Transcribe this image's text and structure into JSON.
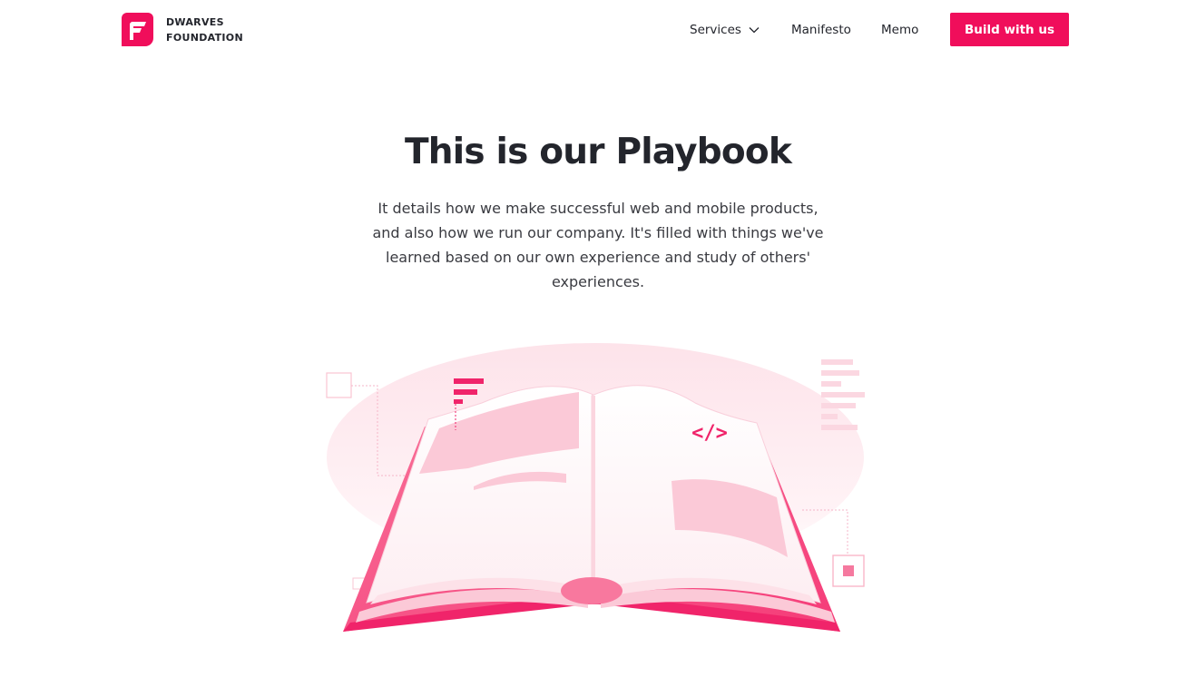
{
  "brand": {
    "line1": "DWARVES",
    "line2": "FOUNDATION",
    "accent": "#f00e5b"
  },
  "nav": {
    "services": "Services",
    "manifesto": "Manifesto",
    "memo": "Memo",
    "cta": "Build with us"
  },
  "hero": {
    "title": "This is our Playbook",
    "lead": "It details how we make successful web and mobile products, and also how we run our company. It's filled with things we've learned based on our own experience and study of others' experiences."
  },
  "illustration": {
    "code_glyph": "</>",
    "icon": "open-book-illustration"
  }
}
